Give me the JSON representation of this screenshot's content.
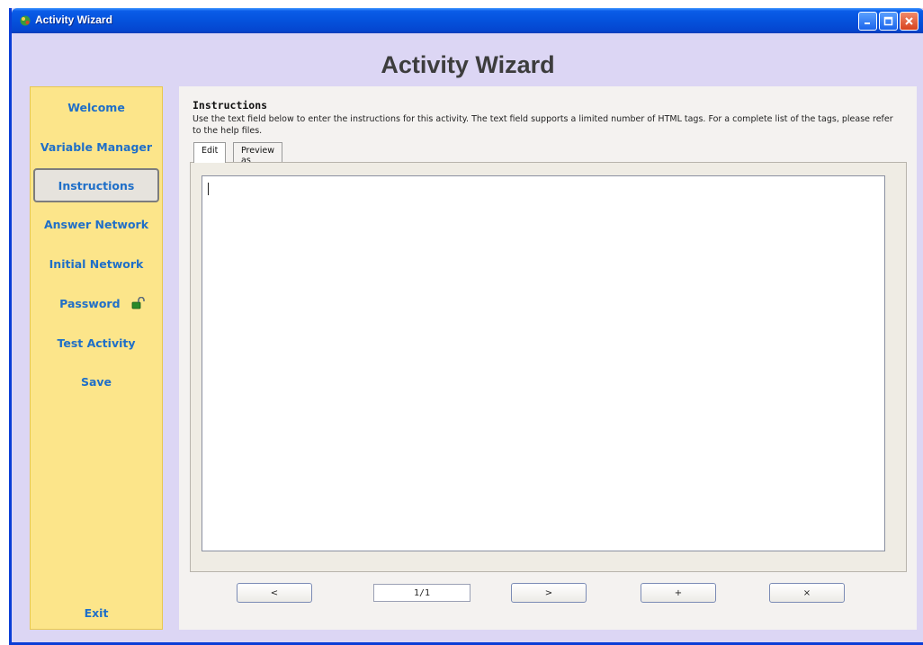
{
  "window": {
    "title": "Activity Wizard"
  },
  "header": {
    "title": "Activity Wizard"
  },
  "sidebar": {
    "items": [
      {
        "label": "Welcome"
      },
      {
        "label": "Variable Manager"
      },
      {
        "label": "Instructions",
        "selected": true
      },
      {
        "label": "Answer Network"
      },
      {
        "label": "Initial Network"
      },
      {
        "label": "Password",
        "icon": "lock-icon"
      },
      {
        "label": "Test Activity"
      },
      {
        "label": "Save"
      }
    ],
    "exit_label": "Exit"
  },
  "main": {
    "section_title": "Instructions",
    "description": "Use the text field below to enter the instructions for this activity. The text field supports a limited number of HTML tags. For a complete list of the tags, please refer to the help files.",
    "tabs": [
      {
        "label": "Edit",
        "active": true
      },
      {
        "label": "Preview as HTML"
      }
    ],
    "editor_value": ""
  },
  "footer": {
    "prev_label": "<",
    "page_indicator": "1/1",
    "next_label": ">",
    "add_label": "+",
    "delete_label": "×"
  },
  "colors": {
    "titlebar": "#0552dc",
    "background": "#dcd6f4",
    "sidebar": "#fce58a",
    "nav_text": "#1f6fc8"
  }
}
